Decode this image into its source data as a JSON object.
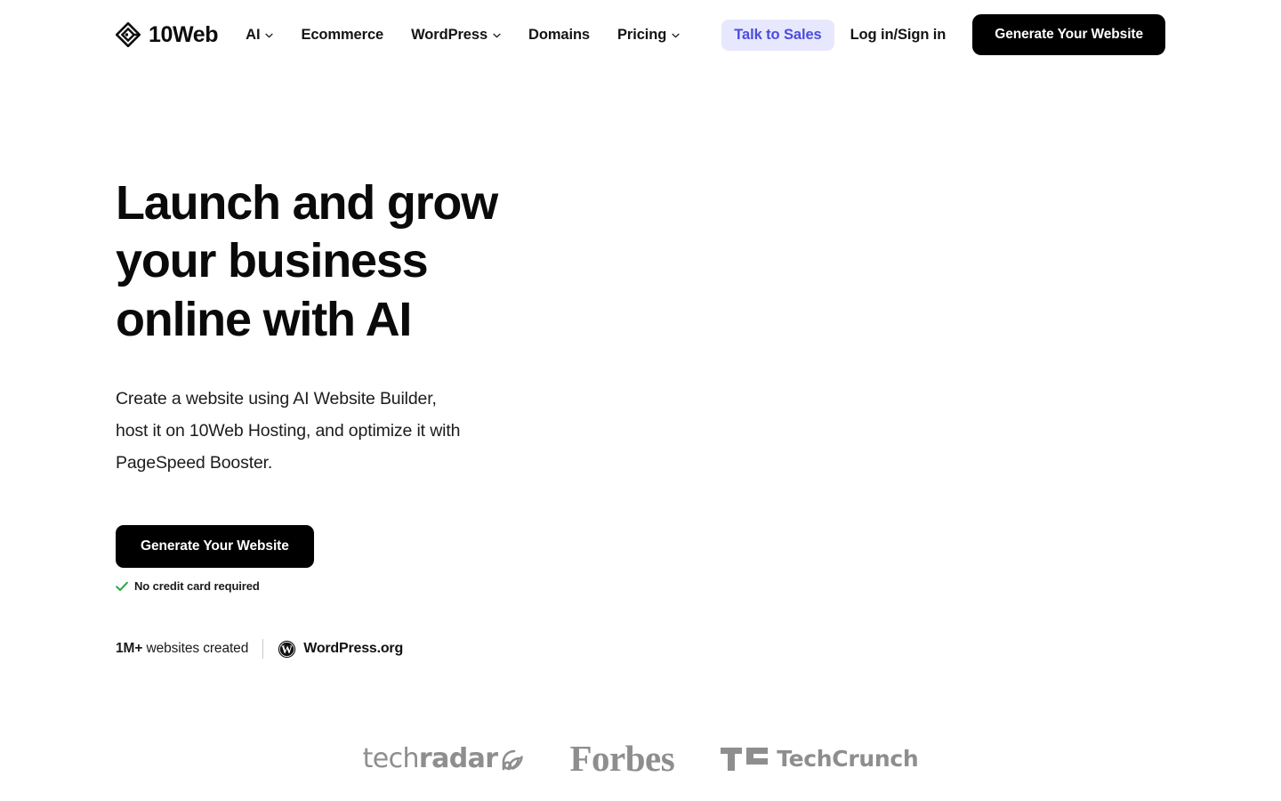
{
  "colors": {
    "accent_indigo": "#4b4ddb",
    "accent_indigo_bg": "#e7e8fd",
    "cta_black": "#000000",
    "check_green": "#2eaa4f",
    "press_gray": "#8e8e8e",
    "text_primary": "#0a0a0a"
  },
  "header": {
    "brand": {
      "name": "10Web",
      "logo_icon": "diamond-logo-icon"
    },
    "nav": [
      {
        "label": "AI",
        "has_dropdown": true,
        "dropdown_icon": "chevron-down-icon"
      },
      {
        "label": "Ecommerce",
        "has_dropdown": false
      },
      {
        "label": "WordPress",
        "has_dropdown": true,
        "dropdown_icon": "chevron-down-icon"
      },
      {
        "label": "Domains",
        "has_dropdown": false
      },
      {
        "label": "Pricing",
        "has_dropdown": true,
        "dropdown_icon": "chevron-down-icon"
      }
    ],
    "talk_to_sales_label": "Talk to Sales",
    "login_label": "Log in/Sign in",
    "cta_label": "Generate Your Website"
  },
  "hero": {
    "title_lines": [
      "Launch and grow",
      "your business",
      "online with AI"
    ],
    "title": "Launch and grow your business online with AI",
    "subtitle_lines": [
      "Create a website using AI Website Builder,",
      "host it on 10Web Hosting, and optimize it with",
      "PageSpeed Booster."
    ],
    "subtitle": "Create a website using AI Website Builder, host it on 10Web Hosting, and optimize it with PageSpeed Booster.",
    "cta_label": "Generate Your Website",
    "no_credit_card": {
      "icon": "check-icon",
      "text": "No credit card required"
    },
    "stats": {
      "count": "1M+",
      "count_suffix": " websites created",
      "wordpress": {
        "icon": "wordpress-icon",
        "label": "WordPress.org"
      }
    }
  },
  "press": [
    {
      "name": "techradar",
      "text_thin": "tech",
      "text_bold": "radar",
      "icon": "signal-icon"
    },
    {
      "name": "Forbes",
      "text": "Forbes"
    },
    {
      "name": "TechCrunch",
      "text": "TechCrunch",
      "icon": "tc-mark-icon"
    }
  ]
}
